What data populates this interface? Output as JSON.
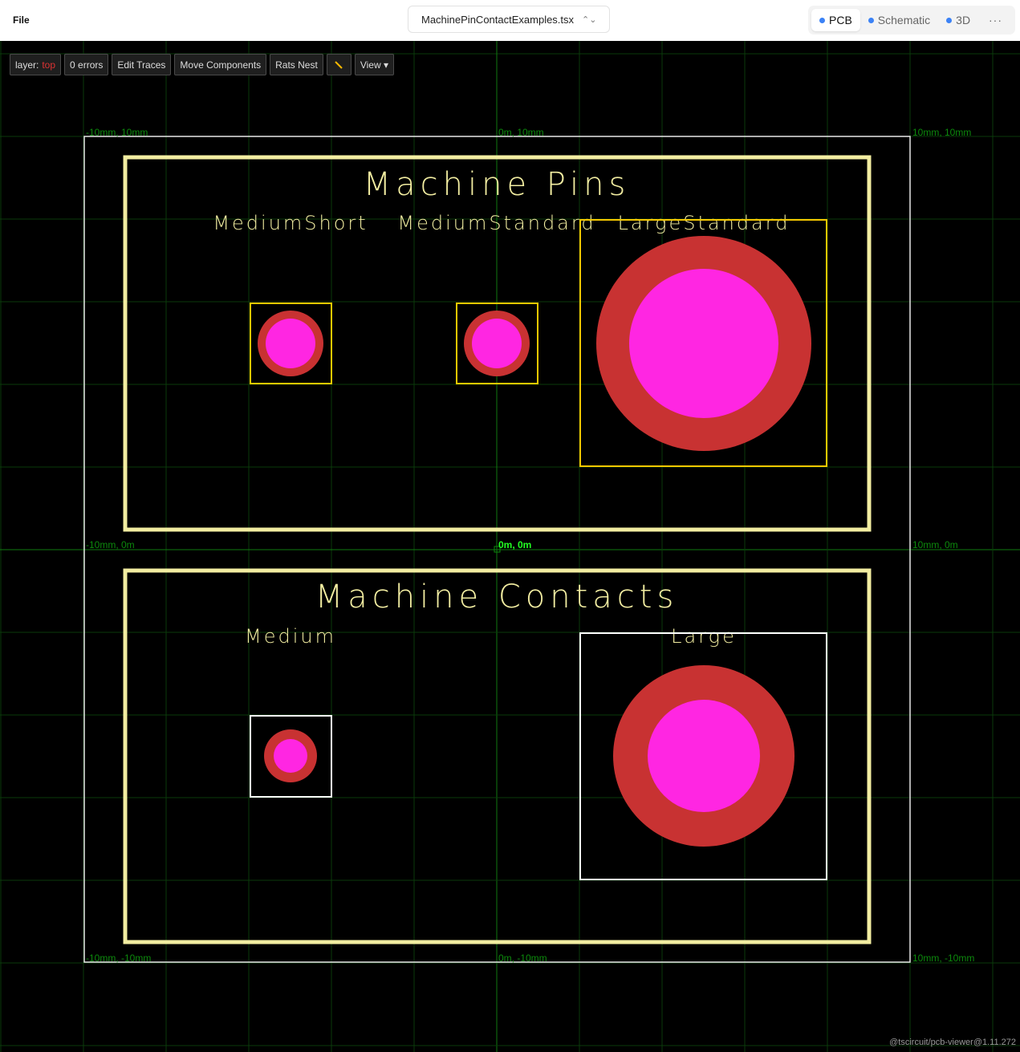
{
  "header": {
    "file_menu": "File",
    "file_name": "MachinePinContactExamples.tsx",
    "tabs": [
      {
        "label": "PCB",
        "active": true
      },
      {
        "label": "Schematic"
      },
      {
        "label": "3D"
      }
    ],
    "more_label": "···",
    "tab_dot_color": "#3b82f6"
  },
  "toolbar": {
    "layer_label": "layer:",
    "layer_value": "top",
    "errors": "0 errors",
    "edit_traces": "Edit Traces",
    "move_components": "Move Components",
    "rats_nest": "Rats Nest",
    "measure_icon": "ruler-icon",
    "view": "View ▾"
  },
  "board": {
    "colors": {
      "silkscreen": "#f2eda1",
      "pad_ring": "#c83232",
      "pad_hole": "#ff26e2",
      "courtyard_pins": "#f5c800",
      "courtyard_contacts": "#ffffff",
      "grid": "#0a3a0a"
    },
    "coords": {
      "tl": "-10mm, 10mm",
      "tc": "0m, 10mm",
      "tr": "10mm, 10mm",
      "ml": "-10mm, 0m",
      "mc": "0m, 0m",
      "mr": "10mm, 0m",
      "bl": "-10mm, -10mm",
      "bc": "0m, -10mm",
      "br": "10mm, -10mm"
    },
    "pins": {
      "title": "Machine Pins",
      "labels": [
        "MediumShort",
        "MediumStandard",
        "LargeStandard"
      ]
    },
    "contacts": {
      "title": "Machine Contacts",
      "labels": [
        "Medium",
        "Large"
      ]
    }
  },
  "footer": {
    "version": "@tscircuit/pcb-viewer@1.11.272"
  }
}
